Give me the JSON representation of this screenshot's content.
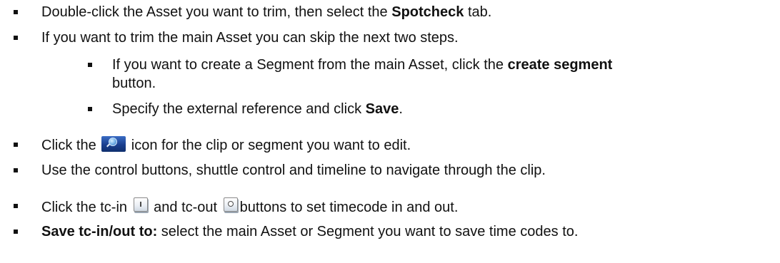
{
  "steps": [
    {
      "pre": "Double-click the Asset you want to trim, then select the ",
      "bold": "Spotcheck",
      "post": " tab."
    },
    {
      "text": "If you want to trim the main Asset you can skip the next two steps."
    },
    {
      "pre": "If you want to create a Segment from the main Asset, click the ",
      "bold": "create segment",
      "line2": "button."
    },
    {
      "pre": "Specify the external reference and click ",
      "bold": "Save",
      "post": "."
    },
    {
      "pre": "Click the ",
      "icon": "magnifier-icon",
      "post": " icon for the clip or segment you want to edit."
    },
    {
      "text": "Use the control buttons, shuttle control and timeline to navigate through the clip."
    },
    {
      "pre": "Click the tc-in ",
      "icon_in": "tc-in-icon",
      "mid": " and tc-out ",
      "icon_out": "tc-out-icon",
      "post": "buttons to set timecode in and out."
    },
    {
      "bold": "Save tc-in/out to:",
      "post": " select the main Asset or Segment you want to save time codes to."
    }
  ]
}
